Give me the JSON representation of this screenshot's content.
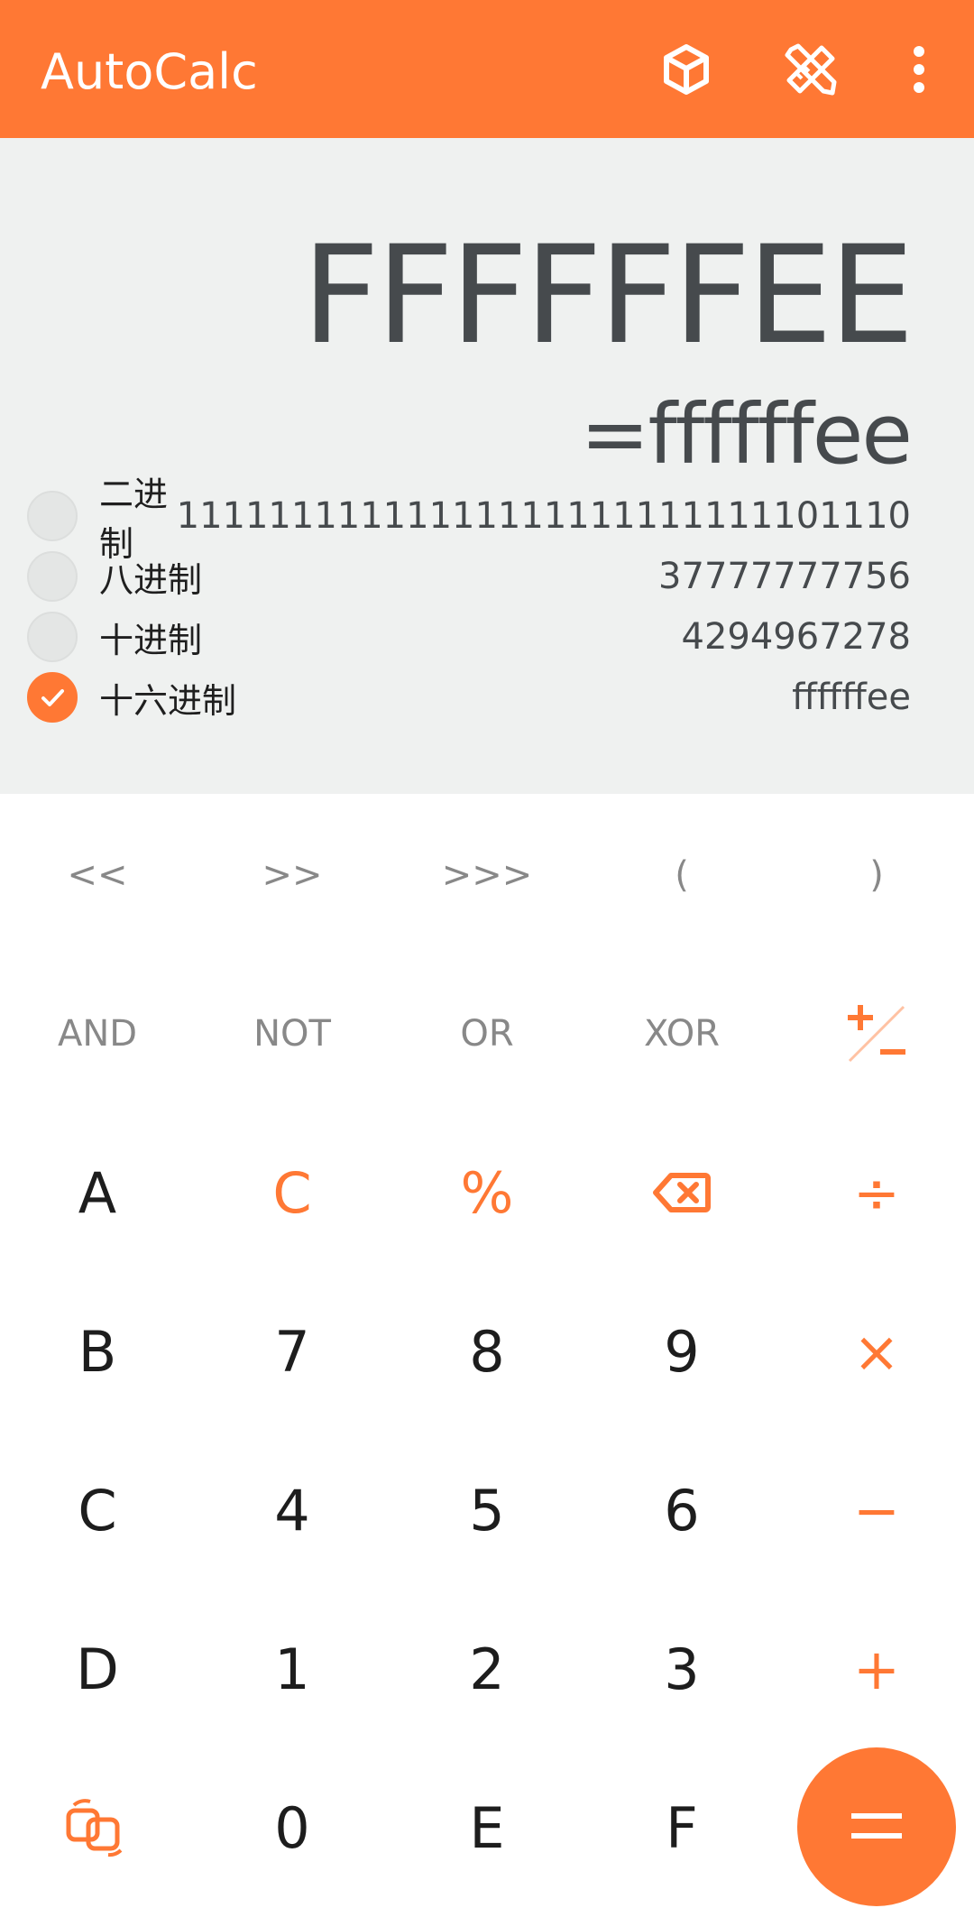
{
  "app": {
    "title": "AutoCalc",
    "icons": [
      "cube-icon",
      "ruler-pencil-icon",
      "more-vert-icon"
    ],
    "accent_color": "#FF7834"
  },
  "display": {
    "expression": "FFFFFFEE",
    "result": "=ffffffee",
    "bases": [
      {
        "label": "二进制",
        "value": "11111111111111111111111111101110",
        "checked": false
      },
      {
        "label": "八进制",
        "value": "37777777756",
        "checked": false
      },
      {
        "label": "十进制",
        "value": "4294967278",
        "checked": false
      },
      {
        "label": "十六进制",
        "value": "ffffffee",
        "checked": true
      }
    ]
  },
  "keypad": {
    "row1": [
      "<<",
      ">>",
      ">>>",
      "(",
      ")"
    ],
    "row2": [
      "AND",
      "NOT",
      "OR",
      "XOR",
      "+/-"
    ],
    "row3": [
      "A",
      "C",
      "%",
      "backspace",
      "÷"
    ],
    "row4": [
      "B",
      "7",
      "8",
      "9",
      "×"
    ],
    "row5": [
      "C",
      "4",
      "5",
      "6",
      "−"
    ],
    "row6": [
      "D",
      "1",
      "2",
      "3",
      "+"
    ],
    "row7": [
      "swap",
      "0",
      "E",
      "F",
      "="
    ]
  }
}
